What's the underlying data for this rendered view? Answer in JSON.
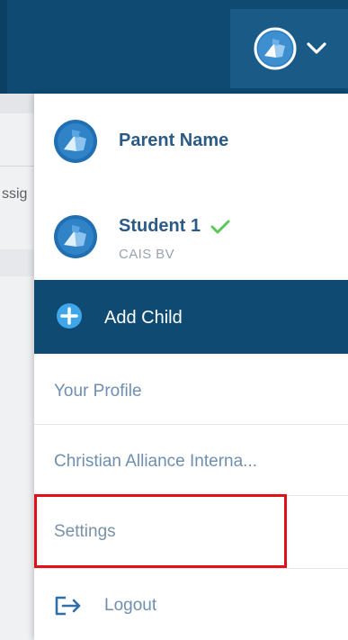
{
  "header": {
    "account_menu": {
      "avatar_icon": "school-logo-icon",
      "chevron_icon": "chevron-down-icon"
    }
  },
  "background": {
    "cut_word": "ssig"
  },
  "dropdown": {
    "parent": {
      "name": "Parent Name",
      "avatar_icon": "school-logo-icon"
    },
    "student": {
      "name": "Student 1",
      "school": "CAIS BV",
      "selected_icon": "check-icon",
      "avatar_icon": "school-logo-icon"
    },
    "add_child": {
      "label": "Add Child",
      "icon": "plus-circle-icon"
    },
    "menu": {
      "your_profile": "Your Profile",
      "organization": "Christian Alliance Interna...",
      "settings": "Settings",
      "logout": "Logout",
      "logout_icon": "logout-icon"
    }
  },
  "colors": {
    "header": "#0e4a72",
    "header_toggle": "#1a5a86",
    "add_child_bg": "#0e4a72",
    "name_text": "#2a5a85",
    "menu_text": "#6e8fb0",
    "check": "#5cc85c",
    "highlight_box": "#e10f1a"
  }
}
